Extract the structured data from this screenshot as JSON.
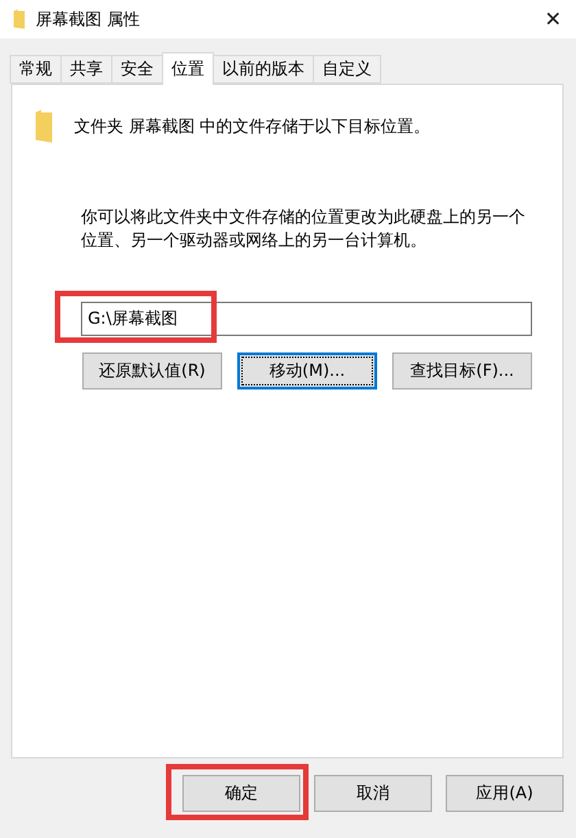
{
  "window": {
    "title": "屏幕截图 属性",
    "close": "✕"
  },
  "tabs": [
    {
      "label": "常规",
      "selected": false
    },
    {
      "label": "共享",
      "selected": false
    },
    {
      "label": "安全",
      "selected": false
    },
    {
      "label": "位置",
      "selected": true
    },
    {
      "label": "以前的版本",
      "selected": false
    },
    {
      "label": "自定义",
      "selected": false
    }
  ],
  "location": {
    "heading": "文件夹 屏幕截图 中的文件存储于以下目标位置。",
    "description": "你可以将此文件夹中文件存储的位置更改为此硬盘上的另一个位置、另一个驱动器或网络上的另一台计算机。",
    "path": {
      "value": "G:\\屏幕截图",
      "highlighted": true
    },
    "buttons": [
      {
        "label": "还原默认值(R)",
        "focused": false
      },
      {
        "label": "移动(M)...",
        "focused": true
      },
      {
        "label": "查找目标(F)...",
        "focused": false
      }
    ]
  },
  "footer_buttons": [
    {
      "label": "确定",
      "highlighted": true
    },
    {
      "label": "取消",
      "highlighted": false
    },
    {
      "label": "应用(A)",
      "highlighted": false
    }
  ]
}
